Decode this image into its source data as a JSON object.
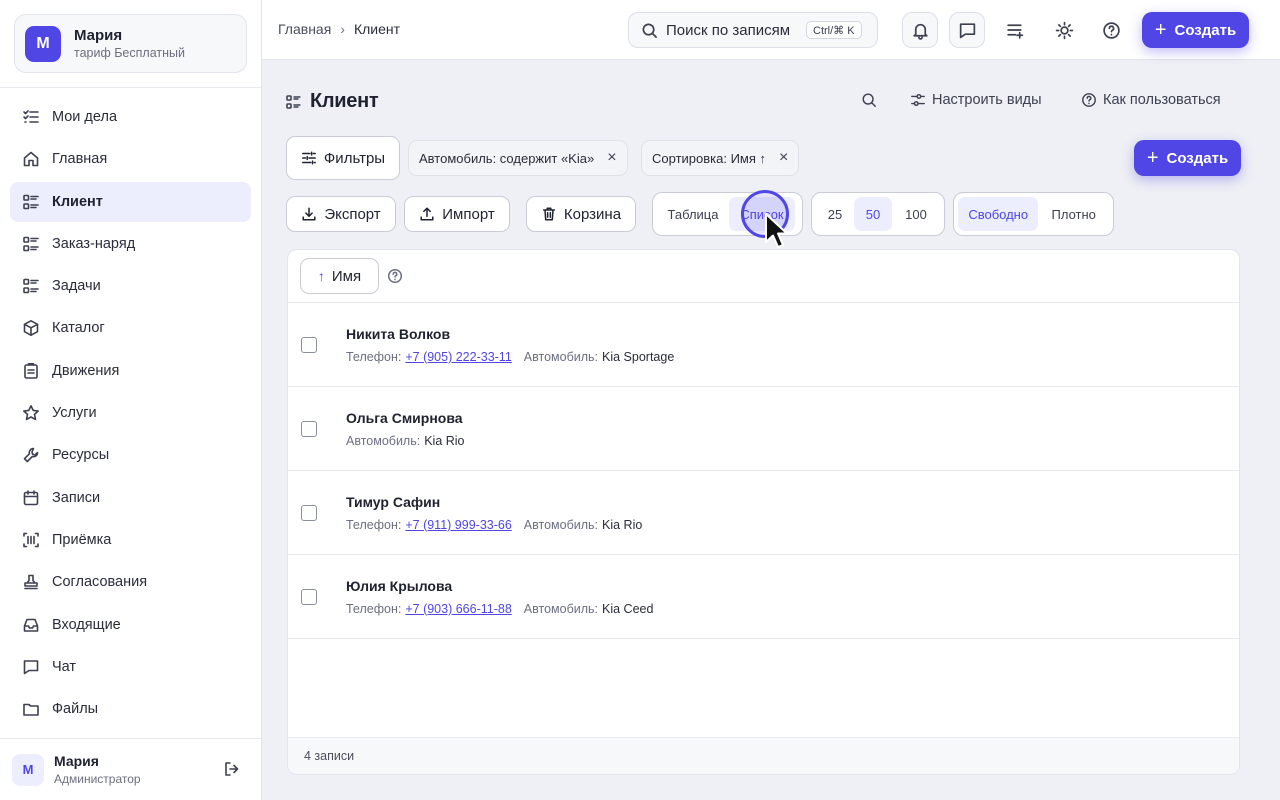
{
  "account": {
    "avatar_letter": "М",
    "name": "Мария",
    "plan": "тариф Бесплатный"
  },
  "sidebar": {
    "items": [
      {
        "label": "Мои дела",
        "icon": "checklist-icon"
      },
      {
        "label": "Главная",
        "icon": "home-icon"
      },
      {
        "label": "Клиент",
        "icon": "list-icon",
        "active": true
      },
      {
        "label": "Заказ-наряд",
        "icon": "list-icon"
      },
      {
        "label": "Задачи",
        "icon": "list-icon"
      },
      {
        "label": "Каталог",
        "icon": "box-icon"
      },
      {
        "label": "Движения",
        "icon": "clipboard-icon"
      },
      {
        "label": "Услуги",
        "icon": "star-icon"
      },
      {
        "label": "Ресурсы",
        "icon": "wrench-icon"
      },
      {
        "label": "Записи",
        "icon": "calendar-icon"
      },
      {
        "label": "Приёмка",
        "icon": "scan-icon"
      },
      {
        "label": "Согласования",
        "icon": "stamp-icon"
      },
      {
        "label": "Входящие",
        "icon": "inbox-icon"
      },
      {
        "label": "Чат",
        "icon": "chat-icon"
      },
      {
        "label": "Файлы",
        "icon": "folder-icon"
      }
    ]
  },
  "user": {
    "avatar_letter": "М",
    "name": "Мария",
    "role": "Администратор"
  },
  "topbar": {
    "breadcrumb": [
      "Главная",
      "Клиент"
    ],
    "search_placeholder": "Поиск по записям",
    "search_shortcut": "Ctrl/⌘ K",
    "create_label": "Создать"
  },
  "page": {
    "title": "Клиент",
    "configure_views": "Настроить виды",
    "how_to_use": "Как пользоваться",
    "filters_label": "Фильтры",
    "chips": [
      "Автомобиль: содержит «Kia»",
      "Сортировка: Имя ↑"
    ],
    "create_label": "Создать",
    "export_label": "Экспорт",
    "import_label": "Импорт",
    "trash_label": "Корзина",
    "view_options": [
      "Таблица",
      "Список"
    ],
    "view_selected": "Список",
    "page_sizes": [
      "25",
      "50",
      "100"
    ],
    "page_size_selected": "50",
    "density_options": [
      "Свободно",
      "Плотно"
    ],
    "density_selected": "Свободно",
    "sort_label": "Имя",
    "labels": {
      "phone": "Телефон:",
      "car": "Автомобиль:"
    },
    "records": [
      {
        "name": "Никита Волков",
        "phone": "+7 (905) 222-33-11",
        "car": "Kia Sportage"
      },
      {
        "name": "Ольга Смирнова",
        "phone": "",
        "car": "Kia Rio"
      },
      {
        "name": "Тимур Сафин",
        "phone": "+7 (911) 999-33-66",
        "car": "Kia Rio"
      },
      {
        "name": "Юлия Крылова",
        "phone": "+7 (903) 666-11-88",
        "car": "Kia Ceed"
      }
    ],
    "records_count": "4 записи"
  },
  "colors": {
    "accent": "#4f46e5",
    "accent_soft": "#eceefe",
    "background": "#eef0f5"
  }
}
